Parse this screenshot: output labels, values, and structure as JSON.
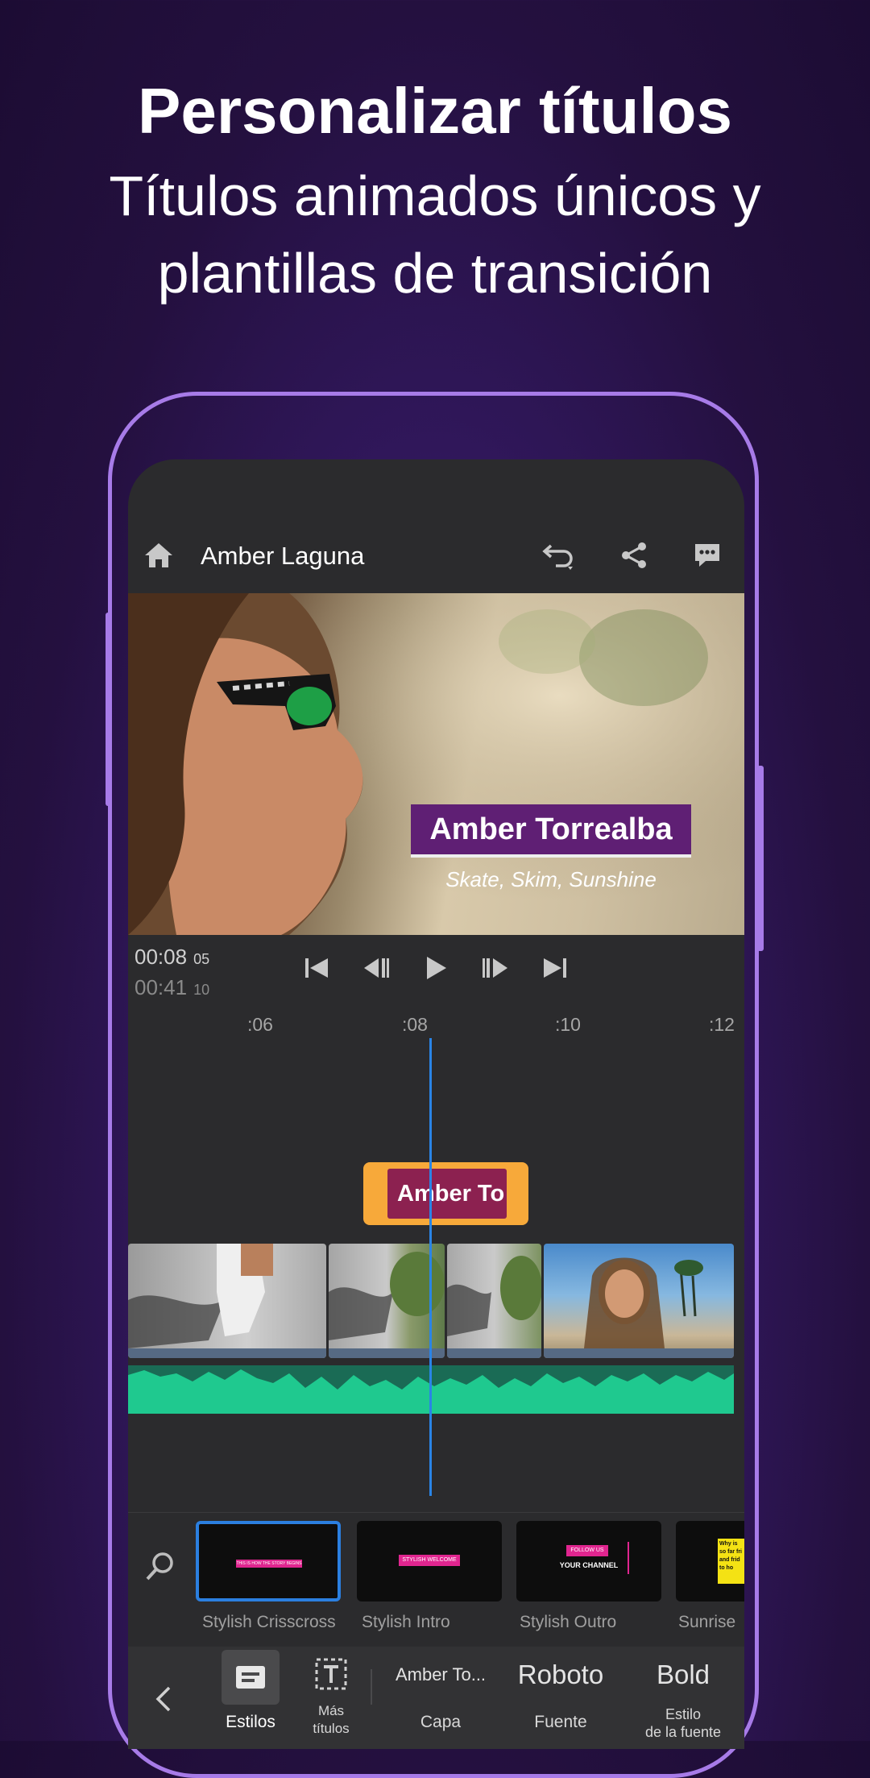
{
  "promo": {
    "headline": "Personalizar títulos",
    "subline_1": "Títulos animados únicos y",
    "subline_2": "plantillas de transición"
  },
  "header": {
    "project_title": "Amber Laguna",
    "icons": [
      "home-icon",
      "undo-icon",
      "share-icon",
      "comment-icon"
    ]
  },
  "preview": {
    "title_text": "Amber Torrealba",
    "subtitle_text": "Skate, Skim, Sunshine"
  },
  "transport": {
    "current_time": "00:08",
    "current_frames": "05",
    "total_time": "00:41",
    "total_frames": "10"
  },
  "timeline": {
    "ruler": [
      ":06",
      ":08",
      ":10",
      ":12"
    ],
    "title_clip_text": "Amber To"
  },
  "styles": {
    "items": [
      {
        "label": "Stylish Crisscross",
        "thumb_text": "THIS IS HOW THE STORY BEGINS",
        "selected": true
      },
      {
        "label": "Stylish Intro",
        "thumb_text": "STYLISH WELCOME",
        "selected": false
      },
      {
        "label": "Stylish Outro",
        "thumb_text": "FOLLOW US",
        "thumb_text_2": "YOUR CHANNEL",
        "selected": false
      },
      {
        "label": "Sunrise",
        "thumb_text": "Why is so far fri and frid to ho",
        "selected": false
      }
    ]
  },
  "toolbar": {
    "estilos": "Estilos",
    "mas_titulos_1": "Más",
    "mas_titulos_2": "títulos",
    "capa_value": "Amber To...",
    "capa_label": "Capa",
    "fuente_value": "Roboto",
    "fuente_label": "Fuente",
    "estilo_value": "Bold",
    "estilo_label_1": "Estilo",
    "estilo_label_2": "de la fuente"
  },
  "colors": {
    "accent_purple": "#a77be8",
    "playhead_blue": "#2a84e6",
    "title_clip_orange": "#f7a93a",
    "audio_green": "#1fc98f"
  }
}
